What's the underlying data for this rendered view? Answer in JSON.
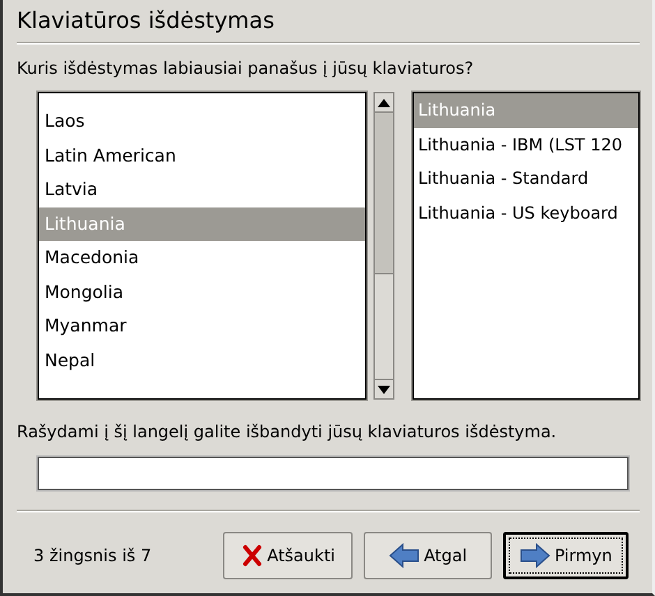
{
  "title": "Klaviatūros išdėstymas",
  "question": "Kuris išdėstymas labiausiai panašus į jūsų klaviaturos?",
  "layouts": [
    {
      "label": "Laos",
      "selected": false
    },
    {
      "label": "Latin American",
      "selected": false
    },
    {
      "label": "Latvia",
      "selected": false
    },
    {
      "label": "Lithuania",
      "selected": true
    },
    {
      "label": "Macedonia",
      "selected": false
    },
    {
      "label": "Mongolia",
      "selected": false
    },
    {
      "label": "Myanmar",
      "selected": false
    },
    {
      "label": "Nepal",
      "selected": false
    }
  ],
  "variants": [
    {
      "label": "Lithuania",
      "selected": true
    },
    {
      "label": "Lithuania - IBM (LST 120",
      "selected": false
    },
    {
      "label": "Lithuania - Standard",
      "selected": false
    },
    {
      "label": "Lithuania - US keyboard",
      "selected": false
    }
  ],
  "test_label": "Rašydami į šį langelį galite išbandyti jūsų klaviaturos išdėstyma.",
  "step": "3 žingsnis iš 7",
  "buttons": [
    {
      "kind": "cancel",
      "label": "Atšaukti",
      "focused": false
    },
    {
      "kind": "back",
      "label": "Atgal",
      "focused": false
    },
    {
      "kind": "forward",
      "label": "Pirmyn",
      "focused": true
    }
  ]
}
